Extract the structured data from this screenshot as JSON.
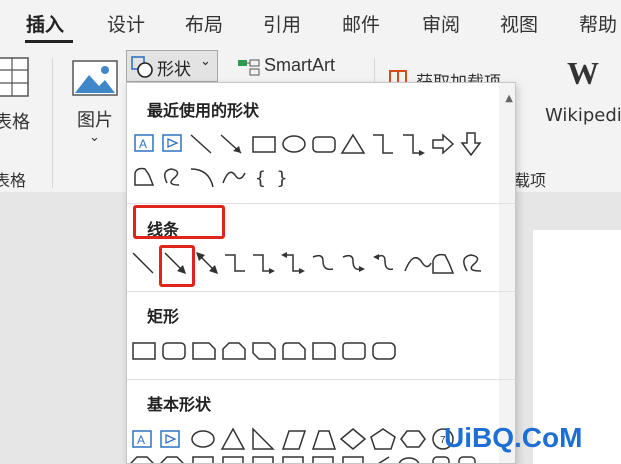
{
  "tabs": [
    {
      "label": "插入",
      "active": true
    },
    {
      "label": "设计"
    },
    {
      "label": "布局"
    },
    {
      "label": "引用"
    },
    {
      "label": "邮件"
    },
    {
      "label": "审阅"
    },
    {
      "label": "视图"
    },
    {
      "label": "帮助"
    }
  ],
  "ribbon": {
    "table_label": "表格",
    "table_group_label": "表格",
    "picture_label": "图片",
    "shapes_button_label": "形状",
    "smartart_label": "SmartArt",
    "addins_label": "获取加载项",
    "addins_group_label": "加载项",
    "wikipedia_label": "Wikipedia",
    "wikipedia_glyph": "W"
  },
  "dropdown": {
    "sections": [
      {
        "title": "最近使用的形状"
      },
      {
        "title": "线条"
      },
      {
        "title": "矩形"
      },
      {
        "title": "基本形状"
      }
    ],
    "recent_braces": "{ }",
    "highlight_color": "#e0241b"
  },
  "watermark": "UiBQ.CoM"
}
